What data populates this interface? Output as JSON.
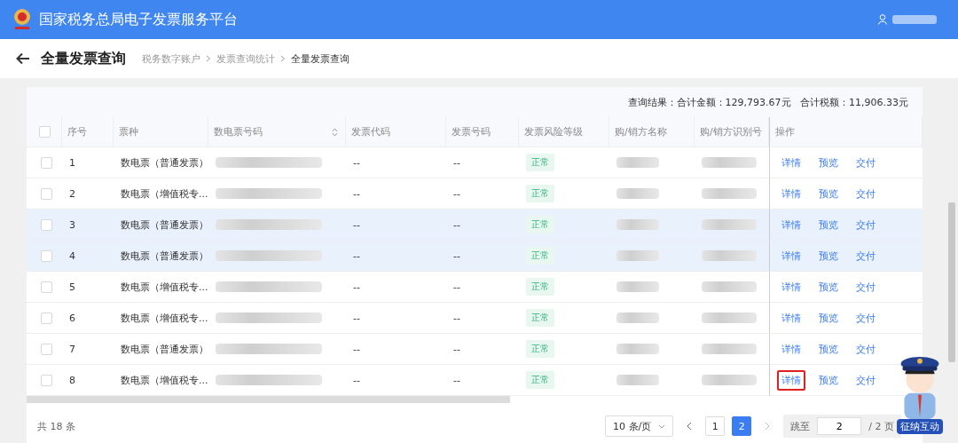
{
  "header": {
    "title": "国家税务总局电子发票服务平台"
  },
  "page": {
    "title": "全量发票查询",
    "breadcrumb": [
      "税务数字账户",
      "发票查询统计",
      "全量发票查询"
    ]
  },
  "summary": "查询结果：合计金额：129,793.67元   合计税额：11,906.33元",
  "table": {
    "columns": [
      "序号",
      "票种",
      "数电票号码",
      "发票代码",
      "发票号码",
      "发票风险等级",
      "购/销方名称",
      "购/销方识别号",
      "操作"
    ],
    "all_checked": false,
    "rows": [
      {
        "no": "1",
        "type": "数电票（普通发票）",
        "code": "--",
        "number": "--",
        "risk": "正常",
        "selected": false,
        "checked": false,
        "actions": [
          {
            "label": "详情",
            "boxed": false
          },
          {
            "label": "预览",
            "boxed": false
          },
          {
            "label": "交付",
            "boxed": false
          }
        ]
      },
      {
        "no": "2",
        "type": "数电票（增值税专...",
        "code": "--",
        "number": "--",
        "risk": "正常",
        "selected": false,
        "checked": false,
        "actions": [
          {
            "label": "详情",
            "boxed": false
          },
          {
            "label": "预览",
            "boxed": false
          },
          {
            "label": "交付",
            "boxed": false
          }
        ]
      },
      {
        "no": "3",
        "type": "数电票（普通发票）",
        "code": "--",
        "number": "--",
        "risk": "正常",
        "selected": true,
        "checked": false,
        "actions": [
          {
            "label": "详情",
            "boxed": false
          },
          {
            "label": "预览",
            "boxed": false
          },
          {
            "label": "交付",
            "boxed": false
          }
        ]
      },
      {
        "no": "4",
        "type": "数电票（普通发票）",
        "code": "--",
        "number": "--",
        "risk": "正常",
        "selected": true,
        "checked": false,
        "actions": [
          {
            "label": "详情",
            "boxed": false
          },
          {
            "label": "预览",
            "boxed": false
          },
          {
            "label": "交付",
            "boxed": false
          }
        ]
      },
      {
        "no": "5",
        "type": "数电票（增值税专...",
        "code": "--",
        "number": "--",
        "risk": "正常",
        "selected": false,
        "checked": false,
        "actions": [
          {
            "label": "详情",
            "boxed": false
          },
          {
            "label": "预览",
            "boxed": false
          },
          {
            "label": "交付",
            "boxed": false
          }
        ]
      },
      {
        "no": "6",
        "type": "数电票（增值税专...",
        "code": "--",
        "number": "--",
        "risk": "正常",
        "selected": false,
        "checked": false,
        "actions": [
          {
            "label": "详情",
            "boxed": false
          },
          {
            "label": "预览",
            "boxed": false
          },
          {
            "label": "交付",
            "boxed": false
          }
        ]
      },
      {
        "no": "7",
        "type": "数电票（普通发票）",
        "code": "--",
        "number": "--",
        "risk": "正常",
        "selected": false,
        "checked": false,
        "actions": [
          {
            "label": "详情",
            "boxed": false
          },
          {
            "label": "预览",
            "boxed": false
          },
          {
            "label": "交付",
            "boxed": false
          }
        ]
      },
      {
        "no": "8",
        "type": "数电票（增值税专...",
        "code": "--",
        "number": "--",
        "risk": "正常",
        "selected": false,
        "checked": false,
        "actions": [
          {
            "label": "详情",
            "boxed": true
          },
          {
            "label": "预览",
            "boxed": false
          },
          {
            "label": "交付",
            "boxed": false
          }
        ]
      }
    ]
  },
  "pagination": {
    "total": "共 18 条",
    "page_size": "10 条/页",
    "pages": [
      {
        "label": "1",
        "selected": false
      },
      {
        "label": "2",
        "selected": true
      }
    ],
    "jump_label": "跳至",
    "jump_value": "2",
    "page_count": "/ 2 页"
  },
  "mascot": {
    "label": "征纳互动"
  }
}
